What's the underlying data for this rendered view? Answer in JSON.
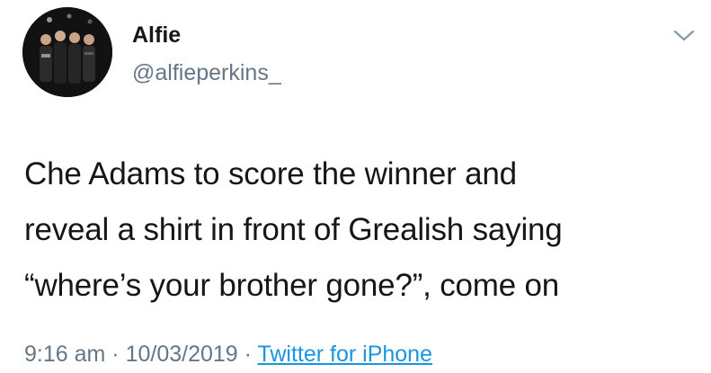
{
  "user": {
    "display_name": "Alfie",
    "handle": "@alfieperkins_"
  },
  "tweet": {
    "lines": [
      "Che Adams to score the winner and",
      "reveal a shirt in front of Grealish saying",
      "“where’s your brother gone?”, come on"
    ]
  },
  "meta": {
    "time": "9:16 am",
    "sep1": " · ",
    "date": "10/03/2019",
    "sep2": " · ",
    "source": "Twitter for iPhone"
  },
  "icons": {
    "menu": "chevron-down-icon"
  },
  "colors": {
    "text": "#14171a",
    "secondary": "#657786",
    "link": "#1b95e0"
  }
}
